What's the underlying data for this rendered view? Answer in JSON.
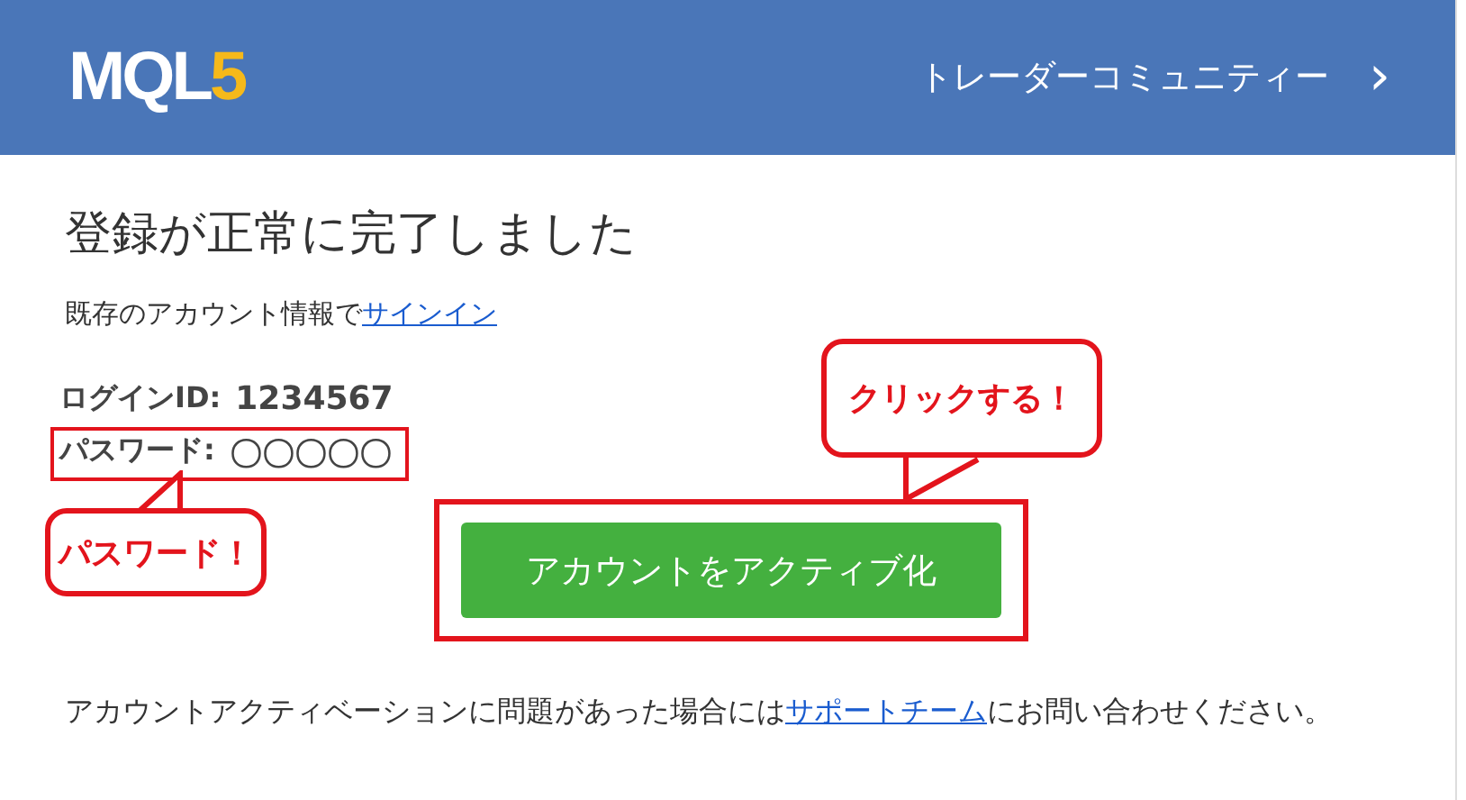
{
  "header": {
    "logo": {
      "text": "MQL",
      "accent": "5"
    },
    "nav_link": "トレーダーコミュニティー",
    "nav_arrow": "›"
  },
  "title": "登録が正常に完了しました",
  "signin": {
    "text": "既存のアカウント情報で",
    "link": "サインイン"
  },
  "credentials": [
    {
      "label": "ログインID:",
      "value": "1234567",
      "highlighted": false
    },
    {
      "label": "パスワード:",
      "value": "〇〇〇〇〇",
      "highlighted": true
    }
  ],
  "activate_button": {
    "label": "アカウントをアクティブ化",
    "highlighted": true
  },
  "callouts": [
    {
      "kind": "below",
      "text": "パスワード！"
    },
    {
      "kind": "above",
      "text": "クリックする！"
    }
  ],
  "footer": {
    "before": "アカウントアクティベーションに問題があった場合には",
    "link": "サポートチーム",
    "after": "にお問い合わせください。"
  }
}
